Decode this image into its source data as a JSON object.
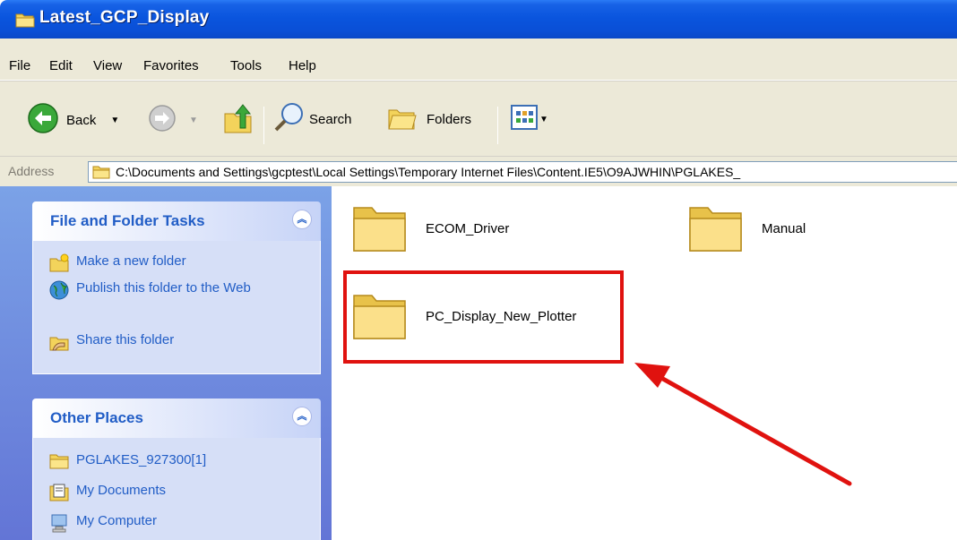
{
  "window": {
    "title": "Latest_GCP_Display"
  },
  "menu": [
    "File",
    "Edit",
    "View",
    "Favorites",
    "Tools",
    "Help"
  ],
  "toolbar": {
    "back_label": "Back",
    "search_label": "Search",
    "folders_label": "Folders"
  },
  "address": {
    "label": "Address",
    "value": "C:\\Documents and Settings\\gcptest\\Local Settings\\Temporary Internet Files\\Content.IE5\\O9AJWHIN\\PGLAKES_"
  },
  "sidebar": {
    "tasks_panel": {
      "title": "File and Folder Tasks",
      "items": [
        {
          "label": "Make a new folder",
          "icon": "new-folder-icon"
        },
        {
          "label": "Publish this folder to the Web",
          "icon": "globe-icon"
        },
        {
          "label": "Share this folder",
          "icon": "share-folder-icon"
        }
      ]
    },
    "places_panel": {
      "title": "Other Places",
      "items": [
        {
          "label": "PGLAKES_927300[1]",
          "icon": "folder-icon"
        },
        {
          "label": "My Documents",
          "icon": "documents-icon"
        },
        {
          "label": "My Computer",
          "icon": "computer-icon"
        }
      ]
    }
  },
  "content": {
    "folders": [
      {
        "name": "ECOM_Driver"
      },
      {
        "name": "Manual"
      },
      {
        "name": "PC_Display_New_Plotter"
      }
    ]
  },
  "colors": {
    "highlight": "#e0120f",
    "titlebar": "#0a55de",
    "task_link": "#215dc6"
  }
}
